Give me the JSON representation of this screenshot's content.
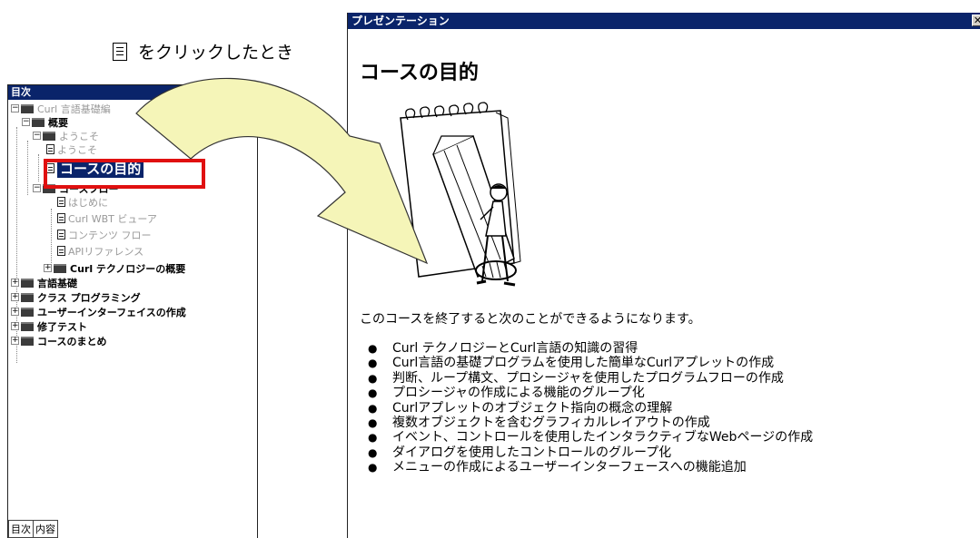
{
  "caption": {
    "text": "をクリックしたとき",
    "icon": "document-icon"
  },
  "toc": {
    "title": "目次",
    "close": "✕",
    "items": [
      {
        "label": "Curl 言語基礎編",
        "kind": "folder",
        "expand": "−",
        "style": "gray"
      },
      {
        "label": "概要",
        "kind": "folder",
        "expand": "−",
        "style": "bold"
      },
      {
        "label": "ようこそ",
        "kind": "folder",
        "expand": "−",
        "style": "gray"
      },
      {
        "label": "ようこそ",
        "kind": "doc",
        "style": "gray"
      },
      {
        "label": "コースの目的",
        "kind": "doc",
        "style": "selected"
      },
      {
        "label": "コースフロー",
        "kind": "folder",
        "expand": "−",
        "style": "bold"
      },
      {
        "label": "はじめに",
        "kind": "doc",
        "style": "gray"
      },
      {
        "label": "Curl WBT ビューア",
        "kind": "doc",
        "style": "gray"
      },
      {
        "label": "コンテンツ フロー",
        "kind": "doc",
        "style": "gray"
      },
      {
        "label": "APIリファレンス",
        "kind": "doc",
        "style": "gray"
      },
      {
        "label": "Curl テクノロジーの概要",
        "kind": "folder",
        "expand": "+",
        "style": "bold"
      },
      {
        "label": "言語基礎",
        "kind": "folder",
        "expand": "+",
        "style": "bold"
      },
      {
        "label": "クラス プログラミング",
        "kind": "folder",
        "expand": "+",
        "style": "bold"
      },
      {
        "label": "ユーザーインターフェイスの作成",
        "kind": "folder",
        "expand": "+",
        "style": "bold"
      },
      {
        "label": "修了テスト",
        "kind": "folder",
        "expand": "+",
        "style": "bold"
      },
      {
        "label": "コースのまとめ",
        "kind": "folder",
        "expand": "+",
        "style": "bold"
      }
    ],
    "tabs": [
      "目次",
      "内容"
    ]
  },
  "presentation": {
    "title": "プレゼンテーション",
    "close": "✕",
    "heading": "コースの目的",
    "illustration": "man-with-giant-pencil-and-notepad-illustration",
    "intro": "このコースを終了すると次のことができるようになります。",
    "bullet": "●",
    "goals": [
      "Curl テクノロジーとCurl言語の知識の習得",
      "Curl言語の基礎プログラムを使用した簡単なCurlアプレットの作成",
      "判断、ループ構文、プロシージャを使用したプログラムフローの作成",
      "プロシージャの作成による機能のグループ化",
      "Curlアプレットのオブジェクト指向の概念の理解",
      "複数オブジェクトを含むグラフィカルレイアウトの作成",
      "イベント、コントロールを使用したインタラクティブなWebページの作成",
      "ダイアログを使用したコントロールのグループ化",
      "メニューの作成によるユーザーインターフェースへの機能追加"
    ]
  },
  "colors": {
    "titlebar": "#0a246a",
    "highlight": "#e01010",
    "arrow_fill": "#f5f5b8"
  }
}
